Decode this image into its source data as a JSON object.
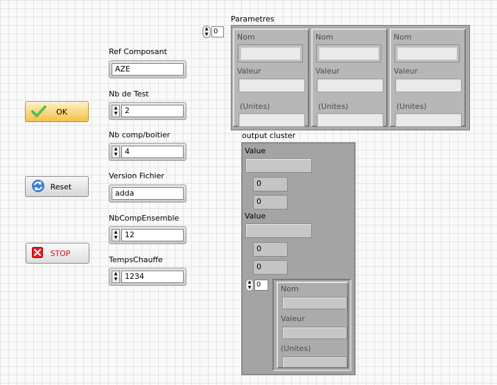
{
  "buttons": {
    "ok_label": "OK",
    "reset_label": "Reset",
    "stop_label": "STOP"
  },
  "controls": {
    "ref_composant": {
      "label": "Ref Composant",
      "value": "AZE"
    },
    "nb_de_test": {
      "label": "Nb de Test",
      "value": "2"
    },
    "nb_comp_boitier": {
      "label": "Nb comp/boitier",
      "value": "4"
    },
    "version_fichier": {
      "label": "Version Fichier",
      "value": "adda"
    },
    "nb_comp_ensemble": {
      "label": "NbCompEnsemble",
      "value": "12"
    },
    "temps_chauffe": {
      "label": "TempsChauffe",
      "value": "1234"
    }
  },
  "parametres": {
    "label": "Parametres",
    "index": "0",
    "elements": [
      {
        "nom": "Nom",
        "valeur": "Valeur",
        "unites": "(Unites)"
      },
      {
        "nom": "Nom",
        "valeur": "Valeur",
        "unites": "(Unites)"
      },
      {
        "nom": "Nom",
        "valeur": "Valeur",
        "unites": "(Unites)"
      }
    ]
  },
  "output_cluster": {
    "label": "output cluster",
    "value1_label": "Value",
    "value1_nums": [
      "0",
      "0"
    ],
    "value2_label": "Value",
    "value2_nums": [
      "0",
      "0"
    ],
    "array_index": "0",
    "inner": {
      "nom": "Nom",
      "valeur": "Valeur",
      "unites": "(Unites)"
    }
  }
}
